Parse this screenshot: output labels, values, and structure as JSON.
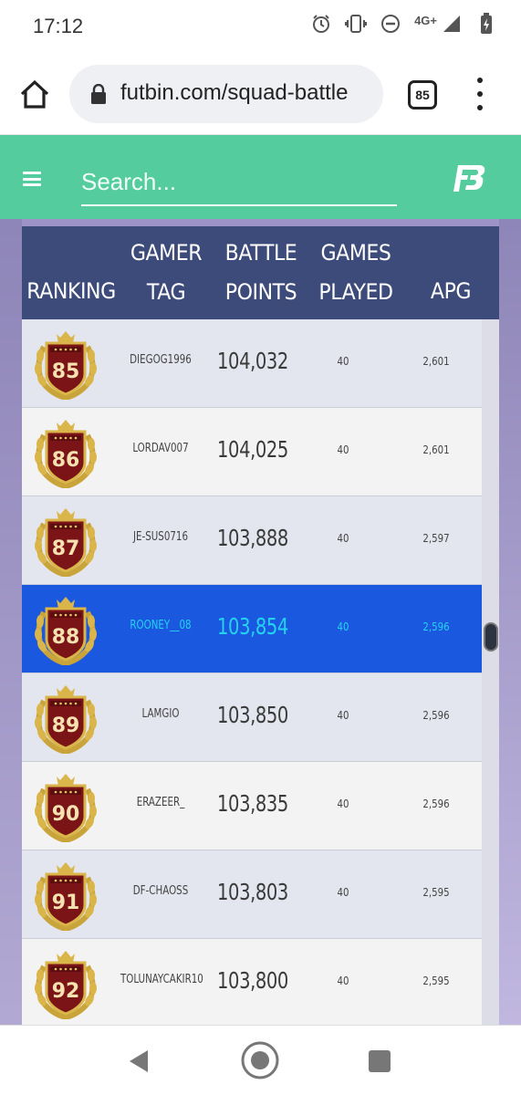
{
  "status_bar": {
    "time": "17:12",
    "network": "4G+",
    "icons": [
      "alarm-icon",
      "vibrate-icon",
      "dnd-icon",
      "signal-icon",
      "battery-charging-icon"
    ]
  },
  "browser": {
    "url": "futbin.com/squad-battle",
    "tab_count": "85",
    "icons": [
      "home-icon",
      "lock-icon",
      "more-vert-icon"
    ]
  },
  "site": {
    "search_placeholder": "Search...",
    "logo": "FB",
    "header_color": "#54cc9e"
  },
  "table": {
    "headers": {
      "ranking": "RANKING",
      "gamer_tag_line1": "GAMER",
      "gamer_tag_line2": "TAG",
      "points_line1": "BATTLE",
      "points_line2": "POINTS",
      "games_line1": "GAMES",
      "games_line2": "PLAYED",
      "apg": "APG"
    },
    "rows": [
      {
        "rank": "85",
        "tag": "DIEGOG1996",
        "points": "104,032",
        "games": "40",
        "apg": "2,601"
      },
      {
        "rank": "86",
        "tag": "LORDAV007",
        "points": "104,025",
        "games": "40",
        "apg": "2,601"
      },
      {
        "rank": "87",
        "tag": "JE-SUS0716",
        "points": "103,888",
        "games": "40",
        "apg": "2,597"
      },
      {
        "rank": "88",
        "tag": "ROONEY__08",
        "points": "103,854",
        "games": "40",
        "apg": "2,596",
        "highlighted": true
      },
      {
        "rank": "89",
        "tag": "LAMGIO",
        "points": "103,850",
        "games": "40",
        "apg": "2,596"
      },
      {
        "rank": "90",
        "tag": "ERAZEER_",
        "points": "103,835",
        "games": "40",
        "apg": "2,596"
      },
      {
        "rank": "91",
        "tag": "DF-CHAOSS",
        "points": "103,803",
        "games": "40",
        "apg": "2,595"
      },
      {
        "rank": "92",
        "tag": "TOLUNAYCAKIR10",
        "points": "103,800",
        "games": "40",
        "apg": "2,595"
      }
    ],
    "header_color": "#3d4b7b",
    "highlight_color": "#1a58e0"
  },
  "nav_bar": {
    "icons": [
      "back-icon",
      "home-circle-icon",
      "recents-icon"
    ]
  }
}
